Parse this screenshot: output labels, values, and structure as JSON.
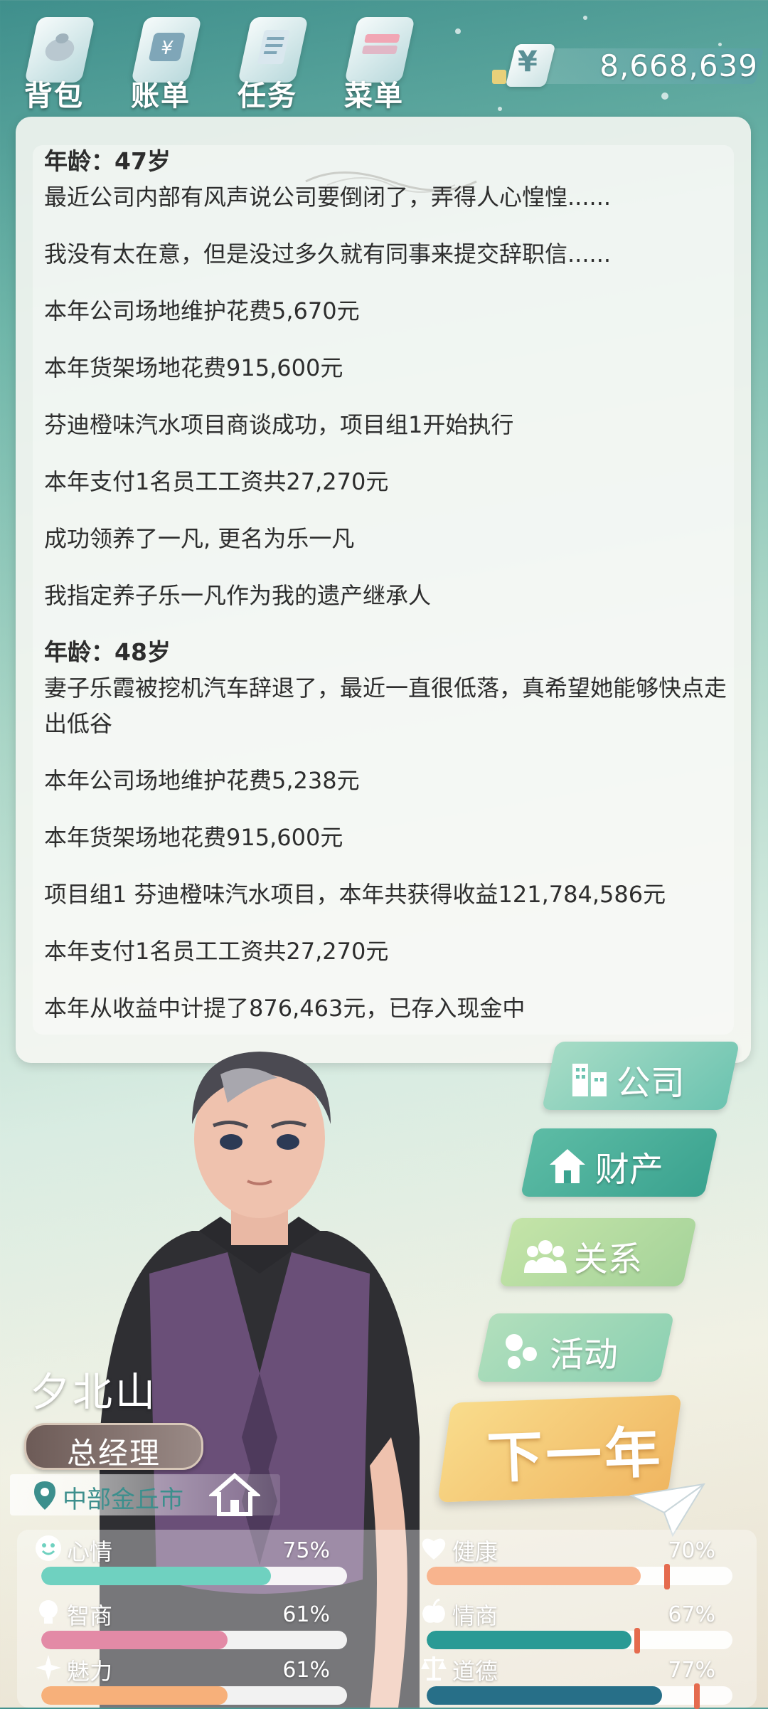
{
  "nav": [
    {
      "label": "背包",
      "icon": "backpack-icon"
    },
    {
      "label": "账单",
      "icon": "bill-icon"
    },
    {
      "label": "任务",
      "icon": "task-icon"
    },
    {
      "label": "菜单",
      "icon": "menu-icon"
    }
  ],
  "money": {
    "symbol": "¥",
    "value": "8,668,639"
  },
  "log": [
    {
      "age": "年龄：47岁",
      "lines": [
        "最近公司内部有风声说公司要倒闭了，弄得人心惶惶......",
        "我没有太在意，但是没过多久就有同事来提交辞职信......",
        "本年公司场地维护花费5,670元",
        "本年货架场地花费915,600元",
        "芬迪橙味汽水项目商谈成功，项目组1开始执行",
        "本年支付1名员工工资共27,270元",
        "成功领养了一凡, 更名为乐一凡",
        "我指定养子乐一凡作为我的遗产继承人"
      ]
    },
    {
      "age": "年龄：48岁",
      "lines": [
        "妻子乐霞被挖机汽车辞退了，最近一直很低落，真希望她能够快点走出低谷",
        "本年公司场地维护花费5,238元",
        "本年货架场地花费915,600元",
        "项目组1 芬迪橙味汽水项目，本年共获得收益121,784,586元",
        "本年支付1名员工工资共27,270元",
        "本年从收益中计提了876,463元，已存入现金中"
      ]
    }
  ],
  "menu": [
    {
      "label": "公司",
      "icon": "building-icon",
      "color_from": "#a7dcc6",
      "color_to": "#6cc3b0"
    },
    {
      "label": "财产",
      "icon": "house-icon",
      "color_from": "#5dbca5",
      "color_to": "#3aa28f"
    },
    {
      "label": "关系",
      "icon": "people-icon",
      "color_from": "#c4e4a8",
      "color_to": "#a5d39a"
    },
    {
      "label": "活动",
      "icon": "activity-icon",
      "color_from": "#b2dfbc",
      "color_to": "#8bd0b2"
    }
  ],
  "next_year": "下一年",
  "character": {
    "name": "夕北山",
    "title": "总经理",
    "location": "中部金丘市"
  },
  "stats": [
    {
      "name": "心情",
      "percent": "75%",
      "value": 0.75,
      "color": "#6fd1c0",
      "icon": "smile-icon"
    },
    {
      "name": "健康",
      "percent": "70%",
      "value": 0.7,
      "color": "#f8b48e",
      "icon": "heart-icon"
    },
    {
      "name": "智商",
      "percent": "61%",
      "value": 0.61,
      "color": "#e38aa6",
      "icon": "bulb-icon"
    },
    {
      "name": "情商",
      "percent": "67%",
      "value": 0.67,
      "color": "#2a9a95",
      "icon": "apple-icon"
    },
    {
      "name": "魅力",
      "percent": "61%",
      "value": 0.61,
      "color": "#f7b07a",
      "icon": "sparkle-icon"
    },
    {
      "name": "道德",
      "percent": "77%",
      "value": 0.77,
      "color": "#276f88",
      "icon": "scale-icon"
    }
  ]
}
